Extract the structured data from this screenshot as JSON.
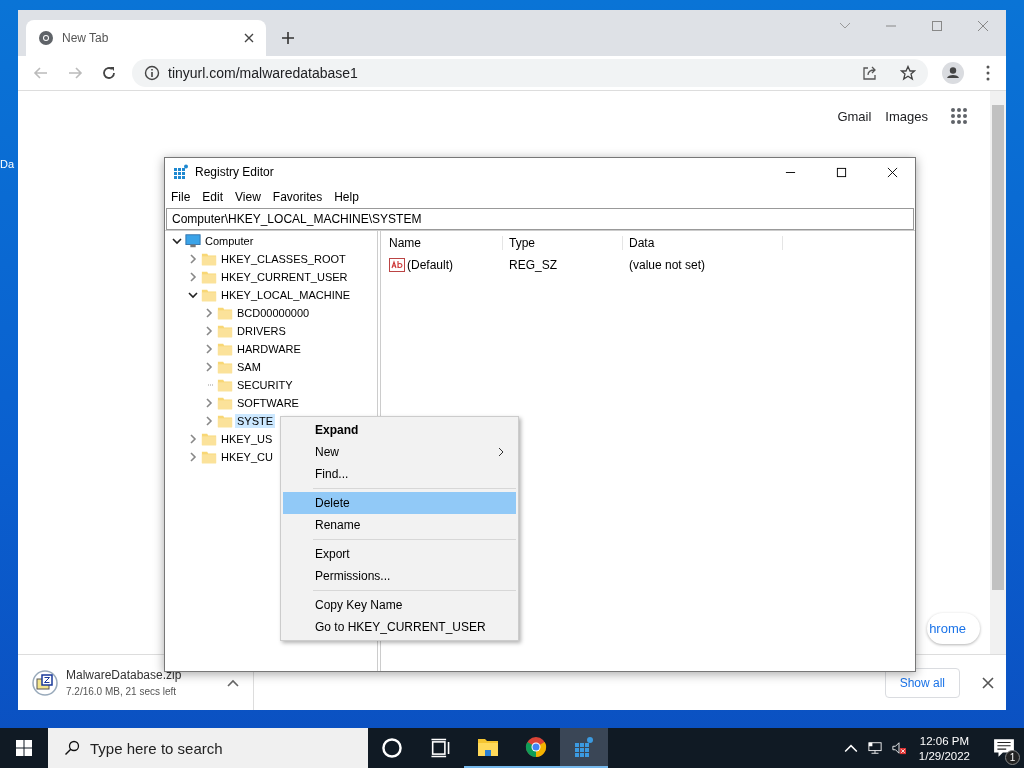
{
  "desktop_icons": [
    {
      "label": "Da"
    }
  ],
  "browser": {
    "tabs": [
      {
        "label": "New Tab",
        "selected": true
      }
    ],
    "address": "tinyurl.com/malwaredatabase1",
    "page_links": [
      "Gmail",
      "Images"
    ],
    "partial_button": "hrome",
    "download": {
      "file": "MalwareDatabase.zip",
      "status": "7.2/16.0 MB, 21 secs left"
    },
    "show_all": "Show all"
  },
  "regedit": {
    "title": "Registry Editor",
    "menu": [
      "File",
      "Edit",
      "View",
      "Favorites",
      "Help"
    ],
    "address": "Computer\\HKEY_LOCAL_MACHINE\\SYSTEM",
    "tree": [
      {
        "label": "Computer",
        "kind": "computer",
        "expandable": true,
        "expanded": true,
        "selected": false,
        "children": [
          {
            "label": "HKEY_CLASSES_ROOT",
            "kind": "folder",
            "expandable": true,
            "expanded": false,
            "selected": false
          },
          {
            "label": "HKEY_CURRENT_USER",
            "kind": "folder",
            "expandable": true,
            "expanded": false,
            "selected": false
          },
          {
            "label": "HKEY_LOCAL_MACHINE",
            "kind": "folder",
            "expandable": true,
            "expanded": true,
            "selected": false,
            "children": [
              {
                "label": "BCD00000000",
                "kind": "folder",
                "expandable": true,
                "expanded": false,
                "selected": false
              },
              {
                "label": "DRIVERS",
                "kind": "folder",
                "expandable": true,
                "expanded": false,
                "selected": false
              },
              {
                "label": "HARDWARE",
                "kind": "folder",
                "expandable": true,
                "expanded": false,
                "selected": false
              },
              {
                "label": "SAM",
                "kind": "folder",
                "expandable": true,
                "expanded": false,
                "selected": false
              },
              {
                "label": "SECURITY",
                "kind": "folder",
                "expandable": false,
                "selected": false
              },
              {
                "label": "SOFTWARE",
                "kind": "folder",
                "expandable": true,
                "expanded": false,
                "selected": false
              },
              {
                "label": "SYSTE",
                "kind": "folder",
                "expandable": true,
                "expanded": false,
                "selected": true
              }
            ]
          },
          {
            "label": "HKEY_US",
            "kind": "folder",
            "expandable": true,
            "expanded": false,
            "selected": false
          },
          {
            "label": "HKEY_CU",
            "kind": "folder",
            "expandable": true,
            "expanded": false,
            "selected": false
          }
        ]
      }
    ],
    "columns": [
      "Name",
      "Type",
      "Data"
    ],
    "values": [
      {
        "name": "(Default)",
        "type": "REG_SZ",
        "data": "(value not set)"
      }
    ]
  },
  "context_menu": [
    {
      "kind": "item",
      "label": "Expand",
      "bold": true,
      "submenu": false,
      "selected": false
    },
    {
      "kind": "item",
      "label": "New",
      "bold": false,
      "submenu": true,
      "selected": false
    },
    {
      "kind": "item",
      "label": "Find...",
      "bold": false,
      "submenu": false,
      "selected": false
    },
    {
      "kind": "separator"
    },
    {
      "kind": "item",
      "label": "Delete",
      "bold": false,
      "submenu": false,
      "selected": true
    },
    {
      "kind": "item",
      "label": "Rename",
      "bold": false,
      "submenu": false,
      "selected": false
    },
    {
      "kind": "separator"
    },
    {
      "kind": "item",
      "label": "Export",
      "bold": false,
      "submenu": false,
      "selected": false
    },
    {
      "kind": "item",
      "label": "Permissions...",
      "bold": false,
      "submenu": false,
      "selected": false
    },
    {
      "kind": "separator"
    },
    {
      "kind": "item",
      "label": "Copy Key Name",
      "bold": false,
      "submenu": false,
      "selected": false
    },
    {
      "kind": "item",
      "label": "Go to HKEY_CURRENT_USER",
      "bold": false,
      "submenu": false,
      "selected": false
    }
  ],
  "taskbar": {
    "search_placeholder": "Type here to search",
    "apps": [
      {
        "kind": "explorer",
        "selected": false
      },
      {
        "kind": "chrome",
        "selected": false
      },
      {
        "kind": "regedit",
        "selected": true
      }
    ],
    "time": "12:06 PM",
    "date": "1/29/2022",
    "notifications": "1"
  }
}
